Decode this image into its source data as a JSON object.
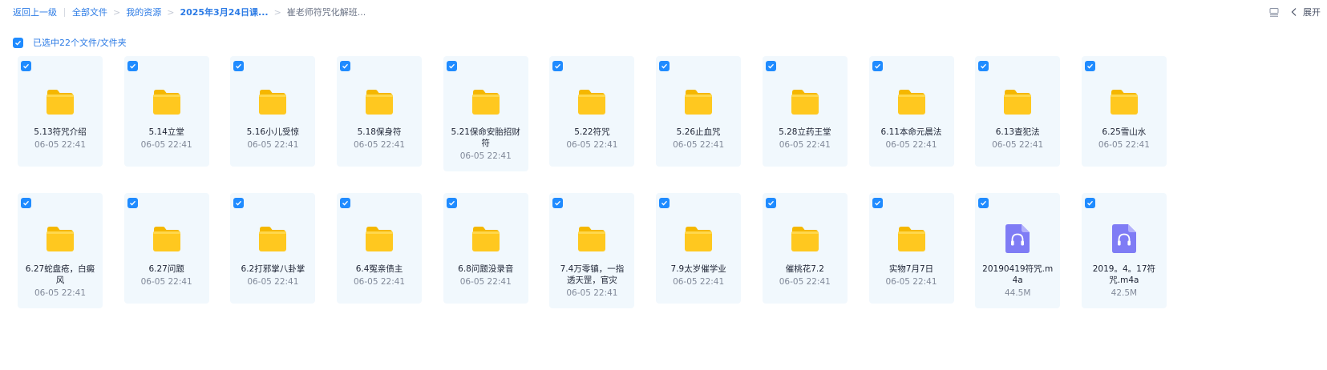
{
  "breadcrumb": {
    "back": "返回上一级",
    "items": [
      "全部文件",
      "我的资源",
      "2025年3月24日课...",
      "崔老师符咒化解班..."
    ]
  },
  "toolbar": {
    "list_icon": "list-view-icon",
    "collapse_icon": "chevron-left-icon",
    "expand_label": "展开"
  },
  "selection": {
    "label": "已选中22个文件/文件夹",
    "checked": true
  },
  "colors": {
    "accent": "#2c7be5",
    "checkbox": "#1f8bff",
    "card_bg": "#f1f8fd",
    "folder": "#ffc81f",
    "audio": "#7f7cf5"
  },
  "files": [
    {
      "name": "5.13符咒介绍",
      "meta": "06-05 22:41",
      "type": "folder"
    },
    {
      "name": "5.14立堂",
      "meta": "06-05 22:41",
      "type": "folder"
    },
    {
      "name": "5.16小儿受惊",
      "meta": "06-05 22:41",
      "type": "folder"
    },
    {
      "name": "5.18保身符",
      "meta": "06-05 22:41",
      "type": "folder"
    },
    {
      "name": "5.21保命安胎招财符",
      "meta": "06-05 22:41",
      "type": "folder"
    },
    {
      "name": "5.22符咒",
      "meta": "06-05 22:41",
      "type": "folder"
    },
    {
      "name": "5.26止血咒",
      "meta": "06-05 22:41",
      "type": "folder"
    },
    {
      "name": "5.28立药王堂",
      "meta": "06-05 22:41",
      "type": "folder"
    },
    {
      "name": "6.11本命元晨法",
      "meta": "06-05 22:41",
      "type": "folder"
    },
    {
      "name": "6.13查犯法",
      "meta": "06-05 22:41",
      "type": "folder"
    },
    {
      "name": "6.25雪山水",
      "meta": "06-05 22:41",
      "type": "folder"
    },
    {
      "name": "6.27蛇盘疮，白癜风",
      "meta": "06-05 22:41",
      "type": "folder"
    },
    {
      "name": "6.27问题",
      "meta": "06-05 22:41",
      "type": "folder"
    },
    {
      "name": "6.2打邪掌八卦掌",
      "meta": "06-05 22:41",
      "type": "folder"
    },
    {
      "name": "6.4冤亲债主",
      "meta": "06-05 22:41",
      "type": "folder"
    },
    {
      "name": "6.8问题没录音",
      "meta": "06-05 22:41",
      "type": "folder"
    },
    {
      "name": "7.4万零镇，一指透天罡，官灾",
      "meta": "06-05 22:41",
      "type": "folder"
    },
    {
      "name": "7.9太岁催学业",
      "meta": "06-05 22:41",
      "type": "folder"
    },
    {
      "name": "催桃花7.2",
      "meta": "06-05 22:41",
      "type": "folder"
    },
    {
      "name": "实物7月7日",
      "meta": "06-05 22:41",
      "type": "folder"
    },
    {
      "name": "20190419符咒.m4a",
      "meta": "44.5M",
      "type": "audio"
    },
    {
      "name": "2019。4。17符咒.m4a",
      "meta": "42.5M",
      "type": "audio"
    }
  ]
}
